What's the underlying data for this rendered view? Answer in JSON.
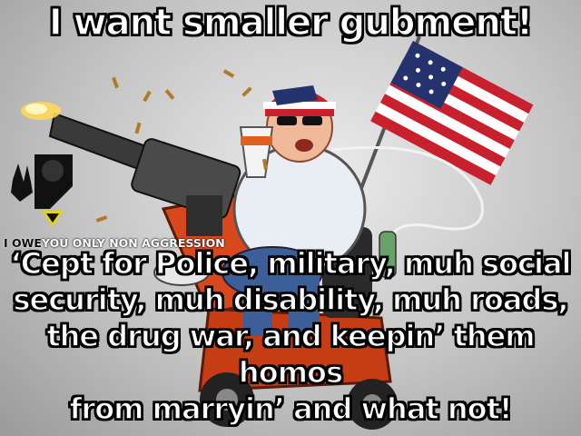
{
  "captions": {
    "top": "I want smaller gubment!",
    "bottom": [
      "‘Cept for Police, military, muh social",
      "security, muh disability, muh roads,",
      "the drug war, and keepin’ them homos",
      "from marryin’ and what not!"
    ]
  },
  "watermark": {
    "part1": "I OWE",
    "part2": "YOU ONLY NON AGGRESSION"
  },
  "colors": {
    "caption_text": "#ffffff",
    "caption_outline": "#000000",
    "scooter": "#d9481c",
    "flag_red": "#c8202c",
    "flag_blue": "#24336e"
  },
  "icons": [
    "american-flag-icon",
    "minigun-icon",
    "mobility-scooter-icon",
    "peace-sign-hand-icon",
    "ancap-logo-icon"
  ]
}
